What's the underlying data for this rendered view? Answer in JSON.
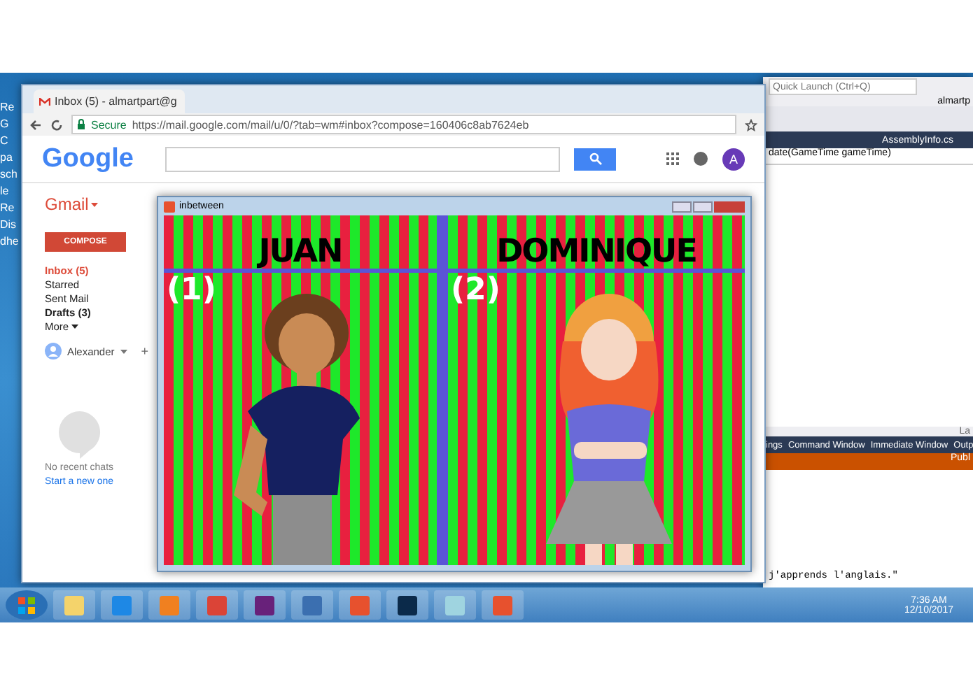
{
  "desktop": {
    "icon_labels": [
      "Re",
      "G",
      "C",
      "pa",
      "sch",
      "le",
      "Re",
      "Dis",
      "dhe"
    ]
  },
  "browser": {
    "tab_title": "Inbox (5) - almartpart@g",
    "secure": "Secure",
    "url": "https://mail.google.com/mail/u/0/?tab=wm#inbox?compose=160406c8ab7624eb",
    "logo": "Google",
    "app_label": "Gmail",
    "compose": "COMPOSE",
    "folders": [
      {
        "label": "Inbox (5)",
        "selected": true,
        "unread": true
      },
      {
        "label": "Starred",
        "selected": false,
        "unread": false
      },
      {
        "label": "Sent Mail",
        "selected": false,
        "unread": false
      },
      {
        "label": "Drafts (3)",
        "selected": false,
        "unread": true
      }
    ],
    "more": "More",
    "account": "Alexander",
    "add": "+",
    "chat_empty": "No recent chats",
    "chat_link": "Start a new one",
    "avatar": "A"
  },
  "ide": {
    "quick_launch": {
      "placeholder": "Quick Launch (Ctrl+Q)"
    },
    "user": "almartp",
    "file_tab": "AssemblyInfo.cs",
    "member": "date(GameTime gameTime)",
    "column_hint": "La",
    "tool_tabs": [
      "ings",
      "Command Window",
      "Immediate Window",
      "Outp"
    ],
    "publish": "Publ",
    "code_line": "j'apprends l'anglais.\""
  },
  "game": {
    "title": "inbetween",
    "players": [
      {
        "name": "JUAN",
        "number": "(1)",
        "kind": "boy"
      },
      {
        "name": "DOMINIQUE",
        "number": "(2)",
        "kind": "girl"
      }
    ]
  },
  "taskbar": {
    "time": "7:36 AM",
    "date": "12/10/2017"
  }
}
